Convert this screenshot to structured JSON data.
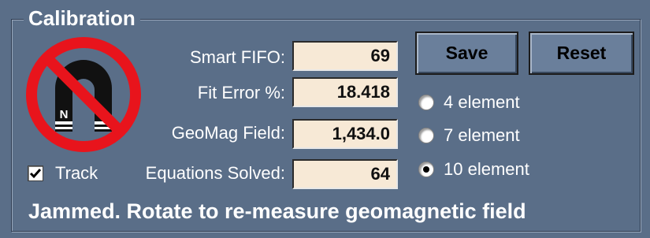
{
  "group": {
    "title": "Calibration"
  },
  "icon": {
    "name": "no-magnet-icon",
    "magnet_pole_n": "N",
    "magnet_pole_s": "S"
  },
  "fields": [
    {
      "label": "Smart FIFO:",
      "value": "69"
    },
    {
      "label": "Fit Error %:",
      "value": "18.418"
    },
    {
      "label": "GeoMag Field:",
      "value": "1,434.0"
    },
    {
      "label": "Equations Solved:",
      "value": "64"
    }
  ],
  "buttons": {
    "save_label": "Save",
    "reset_label": "Reset"
  },
  "radios": [
    {
      "label": "4 element",
      "selected": false
    },
    {
      "label": "7 element",
      "selected": false
    },
    {
      "label": "10 element",
      "selected": true
    }
  ],
  "track": {
    "label": "Track",
    "checked": true
  },
  "status": {
    "message": "Jammed. Rotate to re-measure geomagnetic field"
  },
  "colors": {
    "panel_bg": "#5a6e88",
    "field_bg": "#f7e9d6",
    "prohibition_red": "#e8141c"
  }
}
